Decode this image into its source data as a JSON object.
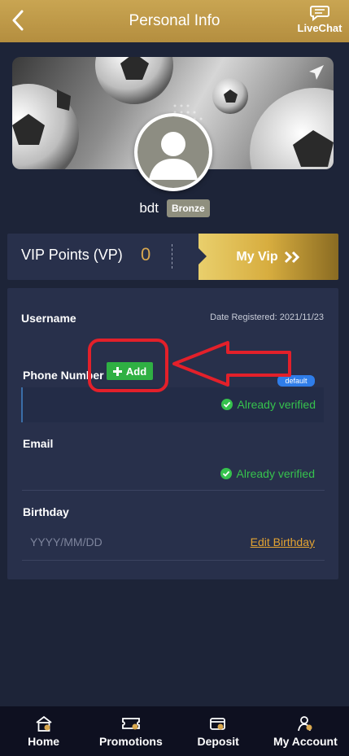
{
  "header": {
    "title": "Personal Info",
    "livechat_label": "LiveChat"
  },
  "profile": {
    "username": "bdt",
    "tier_badge": "Bronze"
  },
  "vip": {
    "label": "VIP Points (VP)",
    "points": "0",
    "button_label": "My Vip",
    "gold": "#d7ad3f"
  },
  "details": {
    "username_label": "Username",
    "date_registered": "Date Registered: 2021/11/23",
    "phone_label": "Phone Number",
    "add_label": "Add",
    "default_tag": "default",
    "phone_verified": "Already verified",
    "email_label": "Email",
    "email_verified": "Already verified",
    "birthday_label": "Birthday",
    "birthday_placeholder": "YYYY/MM/DD",
    "edit_birthday": "Edit Birthday"
  },
  "nav": {
    "items": [
      {
        "label": "Home",
        "icon": "home-icon"
      },
      {
        "label": "Promotions",
        "icon": "ticket-icon"
      },
      {
        "label": "Deposit",
        "icon": "wallet-icon"
      },
      {
        "label": "My Account",
        "icon": "user-icon"
      }
    ]
  },
  "colors": {
    "background": "#1d2438",
    "header_gold": "#c9a552",
    "verified_green": "#36c24d",
    "annotation_red": "#e3202a"
  }
}
